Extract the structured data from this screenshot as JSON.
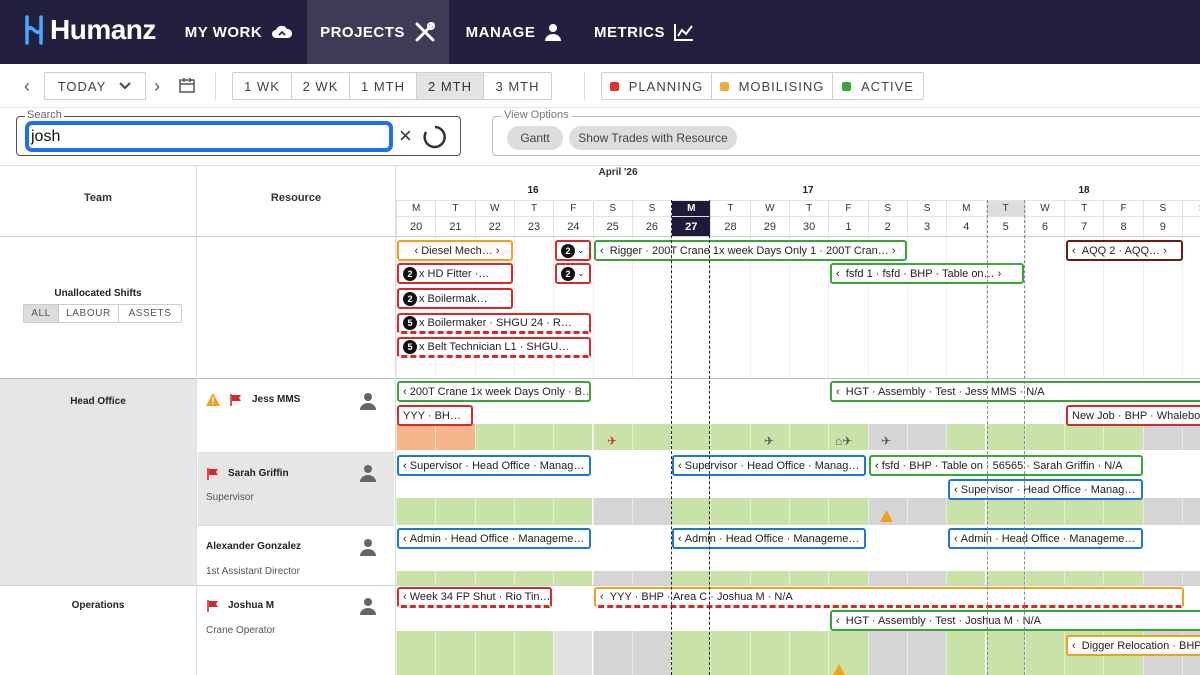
{
  "nav": {
    "logo": "Humanz",
    "items": [
      {
        "label": "MY WORK",
        "icon": "cloud-icon"
      },
      {
        "label": "PROJECTS",
        "icon": "tools-icon"
      },
      {
        "label": "MANAGE",
        "icon": "person-icon"
      },
      {
        "label": "METRICS",
        "icon": "chart-icon"
      }
    ]
  },
  "toolbar": {
    "today": "TODAY",
    "ranges": [
      "1 WK",
      "2 WK",
      "1 MTH",
      "2 MTH",
      "3 MTH"
    ],
    "selected_range": "2 MTH",
    "statuses": [
      {
        "label": "PLANNING",
        "color": "#e03030"
      },
      {
        "label": "MOBILISING",
        "color": "#f2a93b"
      },
      {
        "label": "ACTIVE",
        "color": "#3aa63a"
      }
    ]
  },
  "search": {
    "label": "Search",
    "value": "josh"
  },
  "view_options": {
    "label": "View Options",
    "chips": [
      "Gantt",
      "Show Trades with Resource"
    ]
  },
  "grid": {
    "team_header": "Team",
    "resource_header": "Resource",
    "month": "April '26",
    "weeks": [
      "16",
      "17",
      "18"
    ],
    "day_letters": [
      "M",
      "T",
      "W",
      "T",
      "F",
      "S",
      "S",
      "M",
      "T",
      "W",
      "T",
      "F",
      "S",
      "S",
      "M",
      "T",
      "W",
      "T",
      "F",
      "S",
      "S"
    ],
    "day_numbers": [
      "20",
      "21",
      "22",
      "23",
      "24",
      "25",
      "26",
      "27",
      "28",
      "29",
      "30",
      "1",
      "2",
      "3",
      "4",
      "5",
      "6",
      "7",
      "8",
      "9",
      "1"
    ],
    "today_index": 7
  },
  "unallocated": {
    "title": "Unallocated Shifts",
    "tabs": [
      "ALL",
      "LABOUR",
      "ASSETS"
    ],
    "shifts": [
      {
        "text": "Diesel Mech…",
        "color": "orange"
      },
      {
        "badge": "2",
        "text": "",
        "color": "red"
      },
      {
        "text": "Rigger · 200T Crane 1x week Days Only 1 · 200T Cran…",
        "color": "green"
      },
      {
        "text": "AQQ 2 · AQQ…",
        "color": "maroon"
      },
      {
        "badge": "2",
        "text": "x HD Fitter ·…",
        "color": "red"
      },
      {
        "badge": "2",
        "text": "",
        "color": "red"
      },
      {
        "text": "fsfd 1 · fsfd · BHP · Table on…",
        "color": "green"
      },
      {
        "badge": "2",
        "text": "x Boilermak…",
        "color": "red"
      },
      {
        "badge": "5",
        "text": "x Boilermaker · SHGU 24 · R…",
        "color": "red"
      },
      {
        "badge": "5",
        "text": "x Belt Technician L1 · SHGU…",
        "color": "red"
      }
    ]
  },
  "rows": [
    {
      "team": "Head Office",
      "name": "Jess MMS",
      "role": "",
      "shifts": [
        {
          "text": "200T Crane 1x week Days Only · B…",
          "color": "green"
        },
        {
          "text": "HGT · Assembly · Test · Jess MMS · N/A",
          "color": "green"
        },
        {
          "text": "YYY · BH…",
          "color": "red"
        },
        {
          "text": "New Job · BHP · Whalebo",
          "color": "red"
        }
      ]
    },
    {
      "team": "",
      "name": "Sarah Griffin",
      "role": "Supervisor",
      "shifts": [
        {
          "text": "Supervisor · Head Office · Manag…",
          "color": "blue"
        },
        {
          "text": "Supervisor · Head Office · Manag…",
          "color": "blue"
        },
        {
          "text": "fsfd · BHP · Table on · 56565 · Sarah Griffin · N/A",
          "color": "green"
        },
        {
          "text": "Supervisor · Head Office · Manag…",
          "color": "blue"
        }
      ]
    },
    {
      "team": "",
      "name": "Alexander Gonzalez",
      "role": "1st Assistant Director",
      "shifts": [
        {
          "text": "Admin · Head Office · Manageme…",
          "color": "blue"
        },
        {
          "text": "Admin · Head Office · Manageme…",
          "color": "blue"
        },
        {
          "text": "Admin · Head Office · Manageme…",
          "color": "blue"
        }
      ]
    },
    {
      "team": "Operations",
      "name": "Joshua M",
      "role": "Crane Operator",
      "shifts": [
        {
          "text": "Week 34 FP Shut · Rio Tin…",
          "color": "red"
        },
        {
          "text": "YYY · BHP · Area C · Joshua M · N/A",
          "color": "orange"
        },
        {
          "text": "HGT · Assembly · Test · Joshua M · N/A",
          "color": "green"
        },
        {
          "text": "Digger Relocation · BHP",
          "color": "orange"
        }
      ]
    }
  ]
}
